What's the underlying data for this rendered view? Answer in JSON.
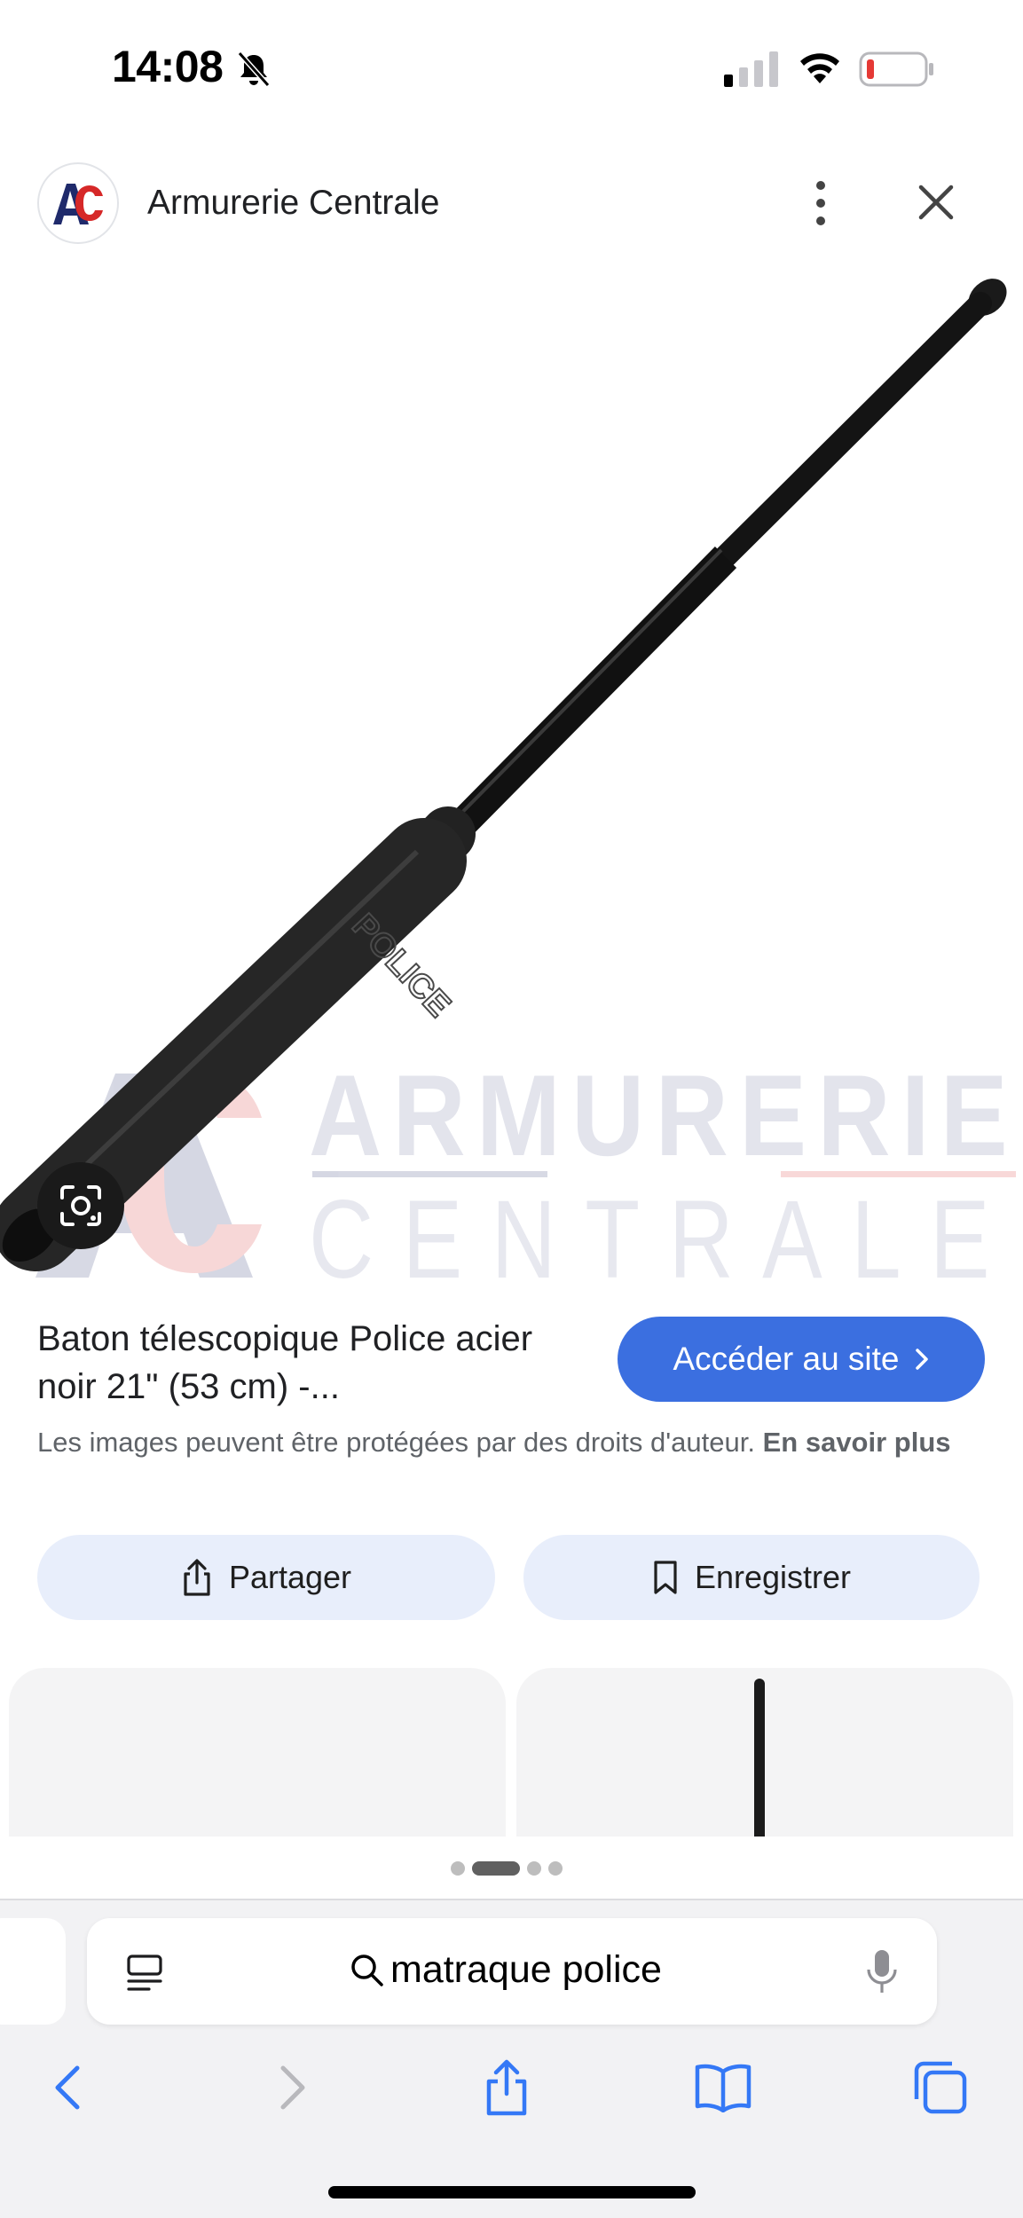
{
  "status_bar": {
    "time": "14:08",
    "icons": [
      "bell-off-icon",
      "signal-icon",
      "wifi-icon",
      "battery-low-icon"
    ],
    "battery_color": "#e53935"
  },
  "header": {
    "site_name": "Armurerie Centrale",
    "logo_text": "AC",
    "logo_colors": {
      "a": "#1f2a6b",
      "c": "#d62828"
    }
  },
  "image": {
    "watermark_line1": "ARMURERIE",
    "watermark_line2": "CENTRALE",
    "handle_text": "POLICE"
  },
  "product": {
    "title": "Baton télescopique Police acier noir 21\" (53 cm) -...",
    "visit_label": "Accéder au site",
    "copyright_text": "Les images peuvent être protégées par des droits d'auteur.",
    "learn_more": "En savoir plus"
  },
  "actions": {
    "share_label": "Partager",
    "save_label": "Enregistrer"
  },
  "pager": {
    "count": 4,
    "active_index": 1
  },
  "browser": {
    "search_query": "matraque police",
    "accent_color": "#3478f6"
  },
  "colors": {
    "visit_button": "#3b6fe0",
    "action_button_bg": "#e8eefb"
  }
}
